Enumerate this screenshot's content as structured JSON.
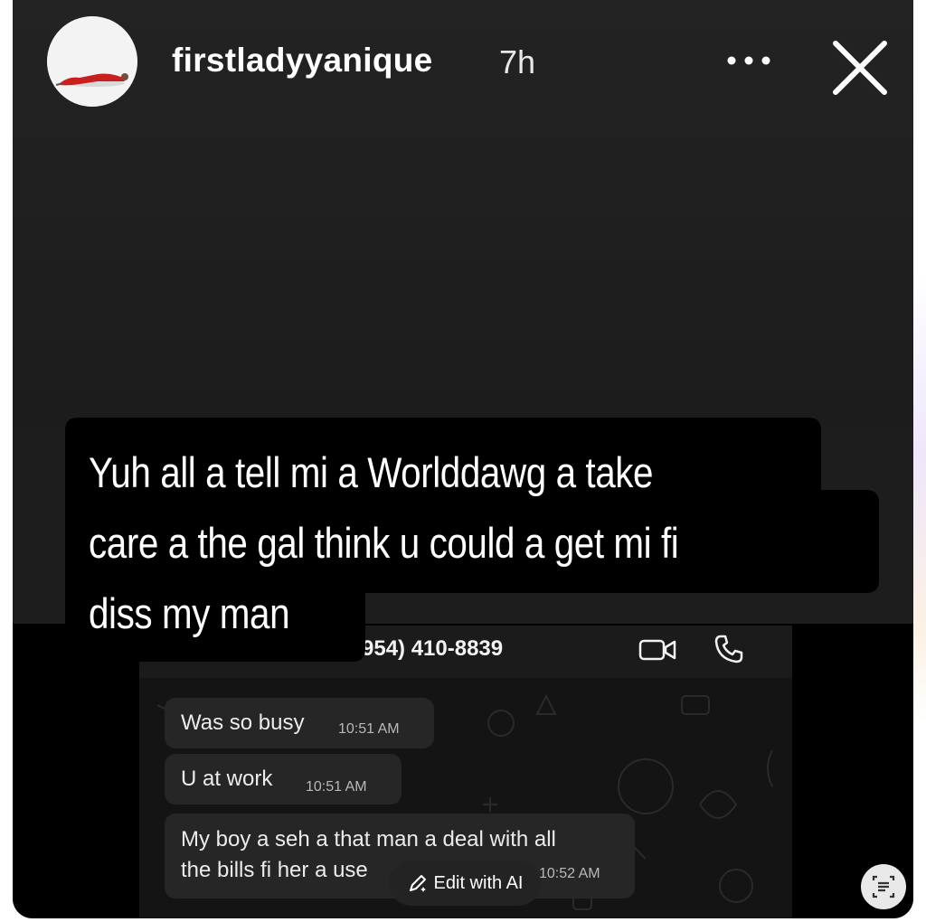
{
  "story": {
    "username": "firstladyyanique",
    "time_ago": "7h",
    "caption_lines": [
      "Yuh all a tell mi a Worlddawg a take",
      "care a the gal think u could a get mi fi",
      "diss my man"
    ]
  },
  "chat": {
    "contact_phone": "954) 410-8839",
    "messages": [
      {
        "text": "Was so busy",
        "time": "10:51 AM"
      },
      {
        "text": "U at work",
        "time": "10:51 AM"
      },
      {
        "text_line1": "My boy a seh a that man a deal with all",
        "text_line2": "the bills fi her a use",
        "time": "10:52 AM"
      }
    ]
  },
  "actions": {
    "edit_with_ai_label": "Edit with AI"
  },
  "icons": {
    "more": "more-dots-icon",
    "close": "close-icon",
    "video": "video-call-icon",
    "call": "phone-icon",
    "pencil": "pencil-sparkle-icon",
    "scan": "text-scan-icon"
  },
  "colors": {
    "story_background": "#1d1d1d",
    "caption_bubble": "#000000",
    "chat_bubble": "#262626",
    "text": "#ffffff"
  }
}
